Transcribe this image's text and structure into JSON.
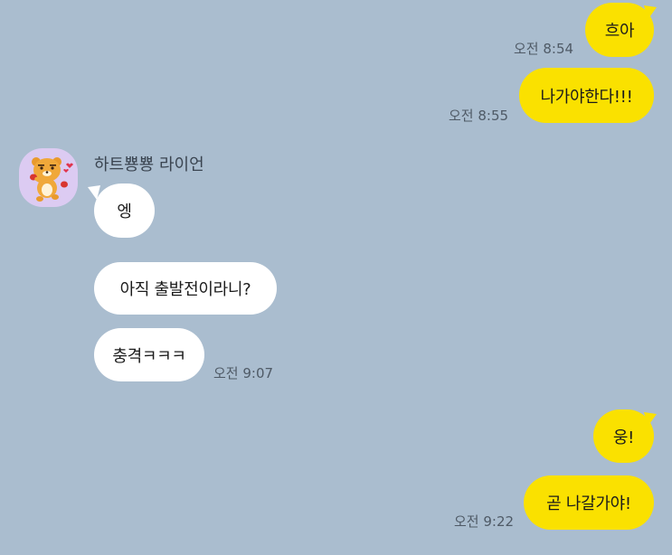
{
  "messages": {
    "m1": {
      "text": "흐아",
      "time": "오전 8:54"
    },
    "m2": {
      "text": "나가야한다!!!",
      "time": "오전 8:55"
    },
    "sender_name": "하트뿅뿅 라이언",
    "m3": {
      "text": "엥"
    },
    "m4": {
      "text": "아직 출발전이라니?"
    },
    "m5": {
      "text": "충격ㅋㅋㅋ",
      "time": "오전 9:07"
    },
    "m6": {
      "text": "웅!"
    },
    "m7": {
      "text": "곧 나갈가야!",
      "time": "오전 9:22"
    }
  },
  "colors": {
    "background": "#aabdcf",
    "my_bubble": "#fae100",
    "their_bubble": "#ffffff",
    "avatar_bg": "#dccbf2"
  },
  "icons": {
    "avatar": "ryan-character-icon"
  }
}
